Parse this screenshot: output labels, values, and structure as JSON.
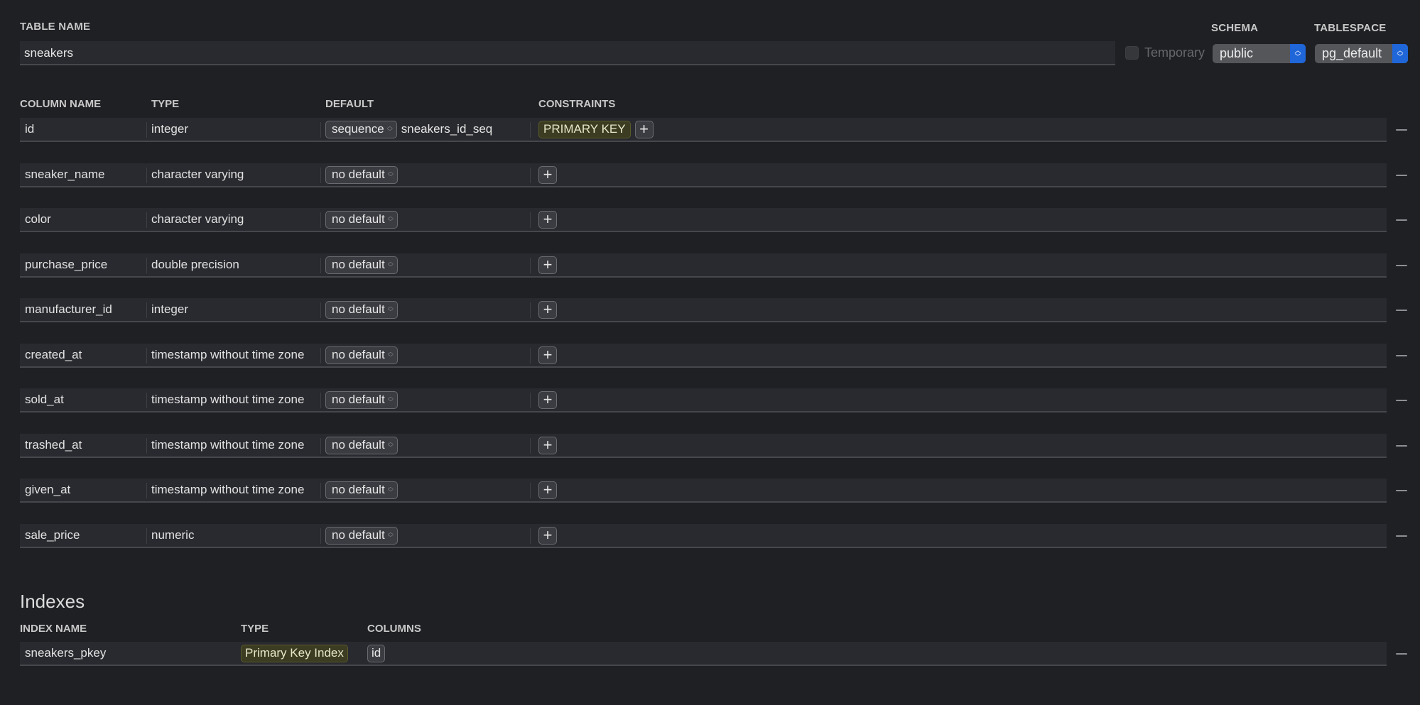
{
  "table": {
    "name_label": "TABLE NAME",
    "name_value": "sneakers",
    "temporary_label": "Temporary",
    "temporary_checked": false,
    "schema_label": "SCHEMA",
    "schema_value": "public",
    "tablespace_label": "TABLESPACE",
    "tablespace_value": "pg_default"
  },
  "columns": {
    "headers": {
      "name": "COLUMN NAME",
      "type": "TYPE",
      "default": "DEFAULT",
      "constraints": "CONSTRAINTS"
    },
    "rows": [
      {
        "name": "id",
        "type": "integer",
        "default": "sequence",
        "default_value": "sneakers_id_seq",
        "constraints": [
          "PRIMARY KEY"
        ]
      },
      {
        "name": "sneaker_name",
        "type": "character varying",
        "default": "no default",
        "default_value": "",
        "constraints": []
      },
      {
        "name": "color",
        "type": "character varying",
        "default": "no default",
        "default_value": "",
        "constraints": []
      },
      {
        "name": "purchase_price",
        "type": "double precision",
        "default": "no default",
        "default_value": "",
        "constraints": []
      },
      {
        "name": "manufacturer_id",
        "type": "integer",
        "default": "no default",
        "default_value": "",
        "constraints": []
      },
      {
        "name": "created_at",
        "type": "timestamp without time zone",
        "default": "no default",
        "default_value": "",
        "constraints": []
      },
      {
        "name": "sold_at",
        "type": "timestamp without time zone",
        "default": "no default",
        "default_value": "",
        "constraints": []
      },
      {
        "name": "trashed_at",
        "type": "timestamp without time zone",
        "default": "no default",
        "default_value": "",
        "constraints": []
      },
      {
        "name": "given_at",
        "type": "timestamp without time zone",
        "default": "no default",
        "default_value": "",
        "constraints": []
      },
      {
        "name": "sale_price",
        "type": "numeric",
        "default": "no default",
        "default_value": "",
        "constraints": []
      }
    ]
  },
  "indexes": {
    "title": "Indexes",
    "headers": {
      "name": "INDEX NAME",
      "type": "TYPE",
      "columns": "COLUMNS"
    },
    "rows": [
      {
        "name": "sneakers_pkey",
        "type": "Primary Key Index",
        "columns": [
          "id"
        ]
      }
    ]
  },
  "colors": {
    "background": "#1f2024",
    "row_background": "#292a2f",
    "accent_blue": "#1f66d9",
    "constraint_badge": "#3c3c22"
  }
}
